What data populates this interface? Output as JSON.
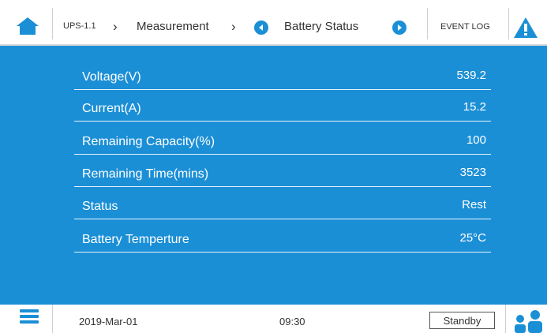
{
  "header": {
    "device": "UPS-1.1",
    "crumb_sep": "›",
    "section": "Measurement",
    "section_sep": "›",
    "page_title": "Battery Status",
    "event_log": "EVENT LOG"
  },
  "icons": {
    "home": "home-icon",
    "prev": "chevron-left-icon",
    "next": "chevron-right-icon",
    "warning": "warning-icon",
    "menu": "menu-icon",
    "users": "users-icon"
  },
  "colors": {
    "accent": "#1b8fd6",
    "panel_text": "#ffffff"
  },
  "measurements": [
    {
      "label": "Voltage(V)",
      "value": "539.2"
    },
    {
      "label": "Current(A)",
      "value": "15.2"
    },
    {
      "label": "Remaining Capacity(%)",
      "value": "100"
    },
    {
      "label": "Remaining Time(mins)",
      "value": "3523"
    },
    {
      "label": "Status",
      "value": "Rest"
    },
    {
      "label": "Battery Temperture",
      "value": "25°C"
    }
  ],
  "footer": {
    "date": "2019-Mar-01",
    "time": "09:30",
    "mode": "Standby"
  }
}
